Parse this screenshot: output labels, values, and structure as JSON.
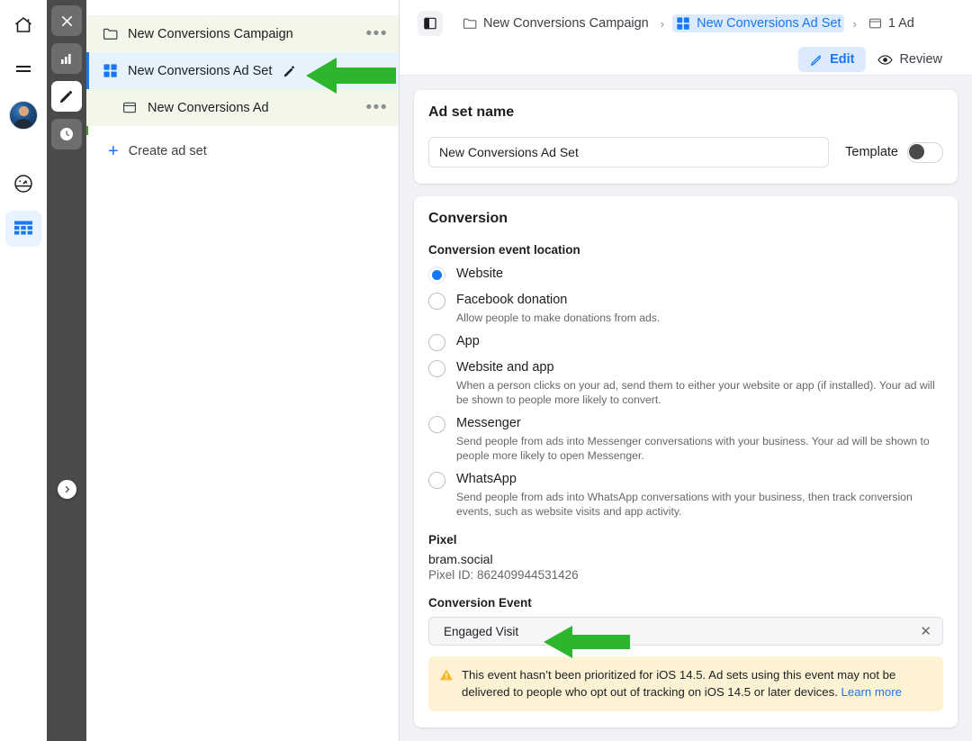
{
  "icon_rail": {
    "items": [
      {
        "name": "home-icon",
        "label": "Home"
      },
      {
        "name": "menu-icon",
        "label": "Menu"
      },
      {
        "name": "avatar",
        "label": "Profile"
      },
      {
        "name": "dashboard-icon",
        "label": "Dashboard"
      },
      {
        "name": "grid-table-icon",
        "label": "Table"
      }
    ]
  },
  "dark_rail": {
    "items": [
      {
        "name": "close-icon",
        "label": "Close"
      },
      {
        "name": "bar-chart-icon",
        "label": "Charts"
      },
      {
        "name": "pencil-icon",
        "label": "Edit"
      },
      {
        "name": "clock-icon",
        "label": "History"
      }
    ],
    "expand_label": "Expand"
  },
  "tree": {
    "rows": [
      {
        "label": "New Conversions Campaign",
        "icon": "folder-icon",
        "menu": "•••"
      },
      {
        "label": "New Conversions Ad Set",
        "icon": "grid-four-icon",
        "menu": ""
      },
      {
        "label": "New Conversions Ad",
        "icon": "ad-card-icon",
        "menu": "•••"
      }
    ],
    "create": {
      "plus": "+",
      "label": "Create ad set"
    }
  },
  "breadcrumb": {
    "items": [
      {
        "label": "New Conversions Campaign",
        "icon": "folder-icon",
        "current": false
      },
      {
        "label": "New Conversions Ad Set",
        "icon": "grid-four-icon",
        "current": true
      },
      {
        "label": "1 Ad",
        "icon": "ad-card-icon",
        "current": false
      }
    ],
    "separator": "›"
  },
  "actions": {
    "edit_label": "Edit",
    "review_label": "Review"
  },
  "ad_set_name": {
    "title": "Ad set name",
    "value": "New Conversions Ad Set",
    "placeholder": "Ad set name",
    "template_label": "Template"
  },
  "conversion": {
    "title": "Conversion",
    "event_location_label": "Conversion event location",
    "options": [
      {
        "title": "Website",
        "desc": "",
        "selected": true
      },
      {
        "title": "Facebook donation",
        "desc": "Allow people to make donations from ads.",
        "selected": false
      },
      {
        "title": "App",
        "desc": "",
        "selected": false
      },
      {
        "title": "Website and app",
        "desc": "When a person clicks on your ad, send them to either your website or app (if installed). Your ad will be shown to people more likely to convert.",
        "selected": false
      },
      {
        "title": "Messenger",
        "desc": "Send people from ads into Messenger conversations with your business. Your ad will be shown to people more likely to open Messenger.",
        "selected": false
      },
      {
        "title": "WhatsApp",
        "desc": "Send people from ads into WhatsApp conversations with your business, then track conversion events, such as website visits and app activity.",
        "selected": false
      }
    ],
    "pixel_label": "Pixel",
    "pixel_name": "bram.social",
    "pixel_id": "Pixel ID: 862409944531426",
    "conversion_event_label": "Conversion Event",
    "conversion_event_value": "Engaged Visit",
    "clear_icon": "✕",
    "warning_text": "This event hasn’t been prioritized for iOS 14.5. Ad sets using this event may not be delivered to people who opt out of tracking on iOS 14.5 or later devices. ",
    "warning_link": "Learn more"
  },
  "colors": {
    "accent_blue": "#1877f2",
    "annotation_green": "#2db52d",
    "tree_green_row": "#f3f7e9",
    "tree_blue_row": "#e6f2fc",
    "warning_bg": "#fdf3d4",
    "dark_rail": "#4a4a4a"
  }
}
